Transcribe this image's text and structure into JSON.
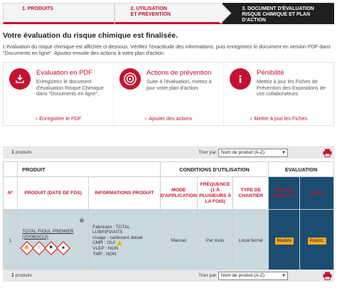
{
  "steps": [
    {
      "label": "1. PRODUITS"
    },
    {
      "label": "2. UTILISATION\nET PRÉVENTION"
    },
    {
      "label": "3. DOCUMENT D'ÉVALUATION\nRISQUE CHIMIQUE ET PLAN\nD'ACTION"
    }
  ],
  "title": "Votre évaluation du risque chimique est finalisée.",
  "intro": "L'évaluation du risque chimique est affichée ci-dessous. Vérifiez l'exactitude des informations, puis enregistrez le document en version PDF dans \"Documents en ligne\". Ajoutez ensuite des actions à votre plan d'action.",
  "cards": [
    {
      "title": "Evaluation en PDF",
      "desc": "Enregistrez le document d'évaluation Risque Chimique dans \"Documents en ligne\".",
      "link": "Enregistrer le PDF",
      "icon": "download-icon"
    },
    {
      "title": "Actions de prévention",
      "desc": "Suite à l'évaluation, mettez à jour votre plan d'action.",
      "link": "Ajouter des actions",
      "icon": "target-icon"
    },
    {
      "title": "Pénibilité",
      "desc": "Mettez à jour les Fiches de Prévention des Expositions de vos collaborateurs",
      "link": "Mettre à jour les Fiches",
      "icon": "info-icon"
    }
  ],
  "table_bar": {
    "count": "1",
    "count_label": "produits",
    "sort_label": "Trier par",
    "sort_value": "Nom de produit (A-Z)"
  },
  "table": {
    "groups": [
      "PRODUIT",
      "CONDITIONS D'UTILISATION",
      "EVALUATION"
    ],
    "columns": [
      "N°",
      "PRODUIT (DATE DE FDS)",
      "INFORMATIONS PRODUIT",
      "MODE D'APPLICATION",
      "FRÉQUENCE (1 À PLUSIEURS À LA FOIS)",
      "TYPE DE CHANTIER",
      "INFLAM MABILITÉ",
      "Santé"
    ],
    "rows": [
      {
        "n": "1",
        "product_name": "TOTAL FIOUL PREMIER",
        "product_date": "(20/08/2013)",
        "info_lines": [
          "Fabricant : TOTAL LUBRIFIANTS",
          "Usage : carburant diesel",
          "CMR : OUI",
          "VLEP : NON",
          "TMP : NON"
        ],
        "mode": "Manuel",
        "frequence": "Par mois",
        "chantier": "Local fermé",
        "inflammabilite": "Modéré",
        "sante": "Préocc."
      }
    ]
  },
  "colors": {
    "brand": "#c41230",
    "eval_bg": "#1a4d70",
    "row_bg": "#c9d9de",
    "badge": "#f5a623"
  }
}
